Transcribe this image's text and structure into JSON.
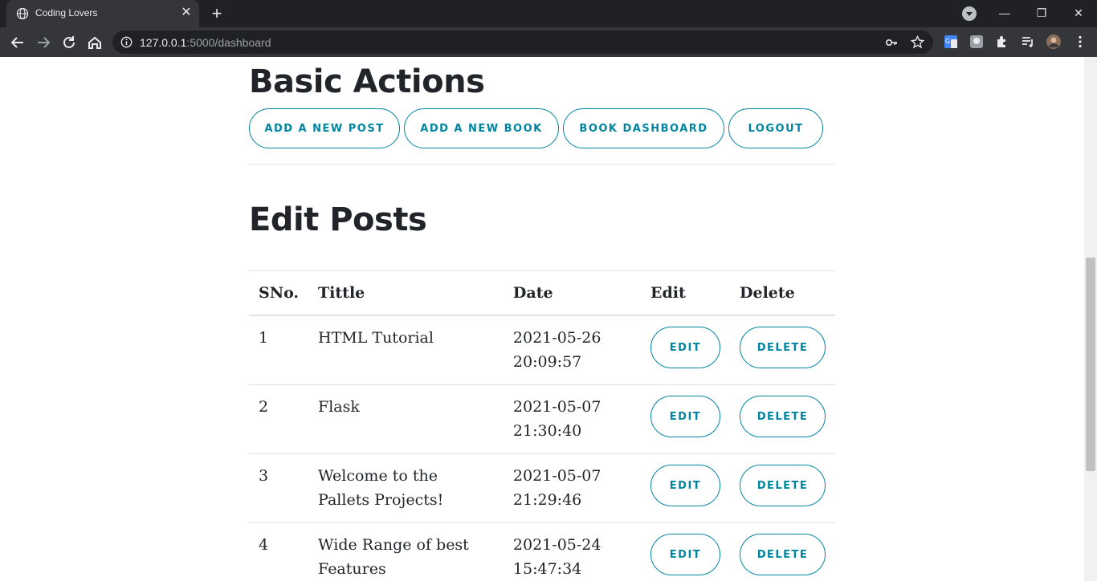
{
  "browser": {
    "tab_title": "Coding Lovers",
    "url_host": "127.0.0.1",
    "url_rest": ":5000/dashboard"
  },
  "page": {
    "basic_actions_heading": "Basic Actions",
    "actions": [
      {
        "label": "ADD A NEW POST"
      },
      {
        "label": "ADD A NEW BOOK"
      },
      {
        "label": "BOOK DASHBOARD"
      },
      {
        "label": "LOGOUT"
      }
    ],
    "edit_posts_heading": "Edit Posts",
    "table": {
      "headers": [
        "SNo.",
        "Tittle",
        "Date",
        "Edit",
        "Delete"
      ],
      "rows": [
        {
          "sno": "1",
          "title": "HTML Tutorial",
          "date": "2021-05-26 20:09:57",
          "edit": "EDIT",
          "delete": "DELETE"
        },
        {
          "sno": "2",
          "title": "Flask",
          "date": "2021-05-07 21:30:40",
          "edit": "EDIT",
          "delete": "DELETE"
        },
        {
          "sno": "3",
          "title": "Welcome to the Pallets Projects!",
          "date": "2021-05-07 21:29:46",
          "edit": "EDIT",
          "delete": "DELETE"
        },
        {
          "sno": "4",
          "title": "Wide Range of best Features",
          "date": "2021-05-24 15:47:34",
          "edit": "EDIT",
          "delete": "DELETE"
        }
      ]
    }
  },
  "colors": {
    "accent": "#0085a1",
    "text": "#212529",
    "chrome_dark": "#202124",
    "chrome_toolbar": "#35363a"
  }
}
